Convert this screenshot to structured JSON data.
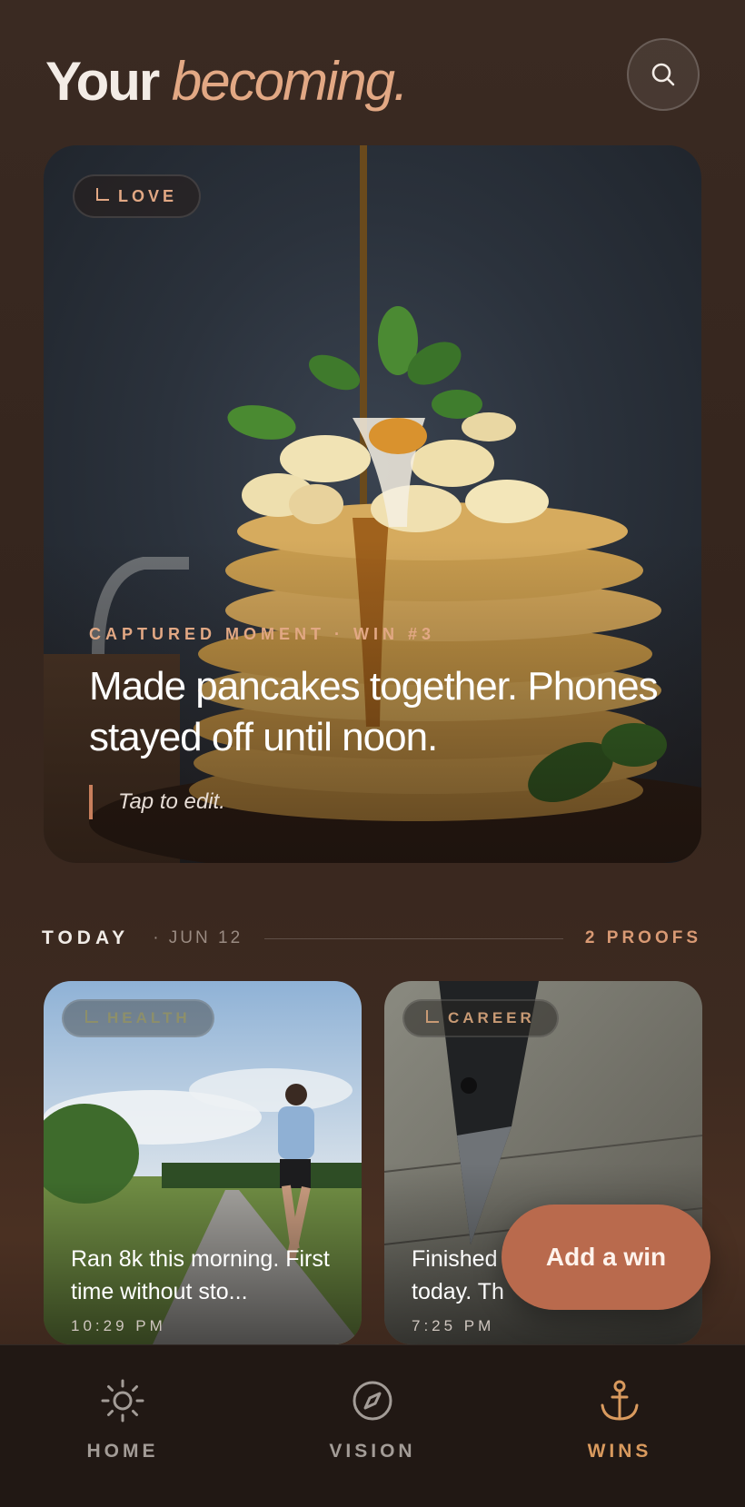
{
  "header": {
    "title_part1": "Your",
    "title_part2": "becoming."
  },
  "hero": {
    "tag": "LOVE",
    "meta": "CAPTURED MOMENT · WIN #3",
    "text": "Made pancakes together. Phones stayed off until noon.",
    "edit_hint": "Tap to edit."
  },
  "section": {
    "label": "TODAY",
    "date": "· JUN 12",
    "count": "2 PROOFS"
  },
  "cards": [
    {
      "tag": "HEALTH",
      "caption": "Ran 8k this morning. First time without sto...",
      "time": "10:29 PM"
    },
    {
      "tag": "CAREER",
      "caption": "Finished today. Th",
      "time": "7:25 PM"
    }
  ],
  "fab": {
    "label": "Add a win"
  },
  "tabs": [
    {
      "label": "HOME",
      "icon": "sun-icon"
    },
    {
      "label": "VISION",
      "icon": "compass-icon"
    },
    {
      "label": "WINS",
      "icon": "anchor-icon"
    }
  ],
  "colors": {
    "accent": "#e2a884",
    "fab": "#b96a4d",
    "active_tab": "#d99a5e"
  }
}
